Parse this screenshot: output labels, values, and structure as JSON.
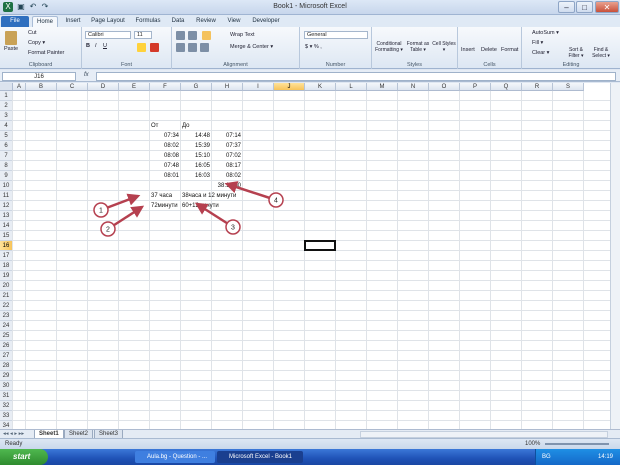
{
  "window": {
    "title": "Book1 - Microsoft Excel",
    "minimize": "–",
    "maximize": "□",
    "close": "✕"
  },
  "tabs": [
    "File",
    "Home",
    "Insert",
    "Page Layout",
    "Formulas",
    "Data",
    "Review",
    "View",
    "Developer"
  ],
  "ribbon": {
    "clipboard": {
      "paste": "Paste",
      "cut": "Cut",
      "copy": "Copy ▾",
      "format_painter": "Format Painter",
      "label": "Clipboard"
    },
    "font": {
      "name": "Calibri",
      "size": "11",
      "label": "Font"
    },
    "alignment": {
      "wrap": "Wrap Text",
      "merge": "Merge & Center ▾",
      "label": "Alignment"
    },
    "number": {
      "format": "General",
      "label": "Number"
    },
    "styles": {
      "cond": "Conditional Formatting ▾",
      "table": "Format as Table ▾",
      "cell": "Cell Styles ▾",
      "label": "Styles"
    },
    "cells": {
      "insert": "Insert",
      "delete": "Delete",
      "format": "Format",
      "label": "Cells"
    },
    "editing": {
      "autosum": "AutoSum ▾",
      "fill": "Fill ▾",
      "clear": "Clear ▾",
      "sort": "Sort & Filter ▾",
      "find": "Find & Select ▾",
      "label": "Editing"
    }
  },
  "formula_bar": {
    "name_box": "J16",
    "fx": "fx",
    "value": ""
  },
  "columns": [
    "A",
    "B",
    "C",
    "D",
    "E",
    "F",
    "G",
    "H",
    "I",
    "J",
    "K",
    "L",
    "M",
    "N",
    "O",
    "P",
    "Q",
    "R",
    "S"
  ],
  "selected_column": "J",
  "rows": [
    "1",
    "2",
    "3",
    "4",
    "5",
    "6",
    "7",
    "8",
    "9",
    "10",
    "11",
    "12",
    "13",
    "14",
    "15",
    "16",
    "17",
    "18",
    "19",
    "20",
    "21",
    "22",
    "23",
    "24",
    "25",
    "26",
    "27",
    "28",
    "29",
    "30",
    "31",
    "32",
    "33",
    "34"
  ],
  "selected_row": "16",
  "cells": [
    {
      "ref": "E4",
      "text": "От",
      "align": "left"
    },
    {
      "ref": "F4",
      "text": "До",
      "align": "left"
    },
    {
      "ref": "E5",
      "text": "07:34",
      "align": "right"
    },
    {
      "ref": "F5",
      "text": "14:48",
      "align": "right"
    },
    {
      "ref": "G5",
      "text": "07:14",
      "align": "right"
    },
    {
      "ref": "E6",
      "text": "08:02",
      "align": "right"
    },
    {
      "ref": "F6",
      "text": "15:39",
      "align": "right"
    },
    {
      "ref": "G6",
      "text": "07:37",
      "align": "right"
    },
    {
      "ref": "E7",
      "text": "08:08",
      "align": "right"
    },
    {
      "ref": "F7",
      "text": "15:10",
      "align": "right"
    },
    {
      "ref": "G7",
      "text": "07:02",
      "align": "right"
    },
    {
      "ref": "E8",
      "text": "07:48",
      "align": "right"
    },
    {
      "ref": "F8",
      "text": "16:05",
      "align": "right"
    },
    {
      "ref": "G8",
      "text": "08:17",
      "align": "right"
    },
    {
      "ref": "E9",
      "text": "08:01",
      "align": "right"
    },
    {
      "ref": "F9",
      "text": "16:03",
      "align": "right"
    },
    {
      "ref": "G9",
      "text": "08:02",
      "align": "right"
    },
    {
      "ref": "G10",
      "text": "38:12:00",
      "align": "right"
    },
    {
      "ref": "E11",
      "text": "37 часа",
      "align": "left"
    },
    {
      "ref": "F11",
      "text": "38часа и 12 минути",
      "align": "left"
    },
    {
      "ref": "E12",
      "text": "72минути",
      "align": "left"
    },
    {
      "ref": "F12",
      "text": "60+12минути",
      "align": "left"
    }
  ],
  "callouts": [
    "1",
    "2",
    "3",
    "4"
  ],
  "callout_color": "#b5404f",
  "sheets": [
    "Sheet1",
    "Sheet2",
    "Sheet3"
  ],
  "active_sheet": "Sheet1",
  "status": {
    "ready": "Ready",
    "zoom": "100%"
  },
  "taskbar": {
    "start": "start",
    "buttons": [
      "Aula.bg - Question - ...",
      "Microsoft Excel - Book1"
    ],
    "lang": "BG",
    "time": "14:19"
  }
}
